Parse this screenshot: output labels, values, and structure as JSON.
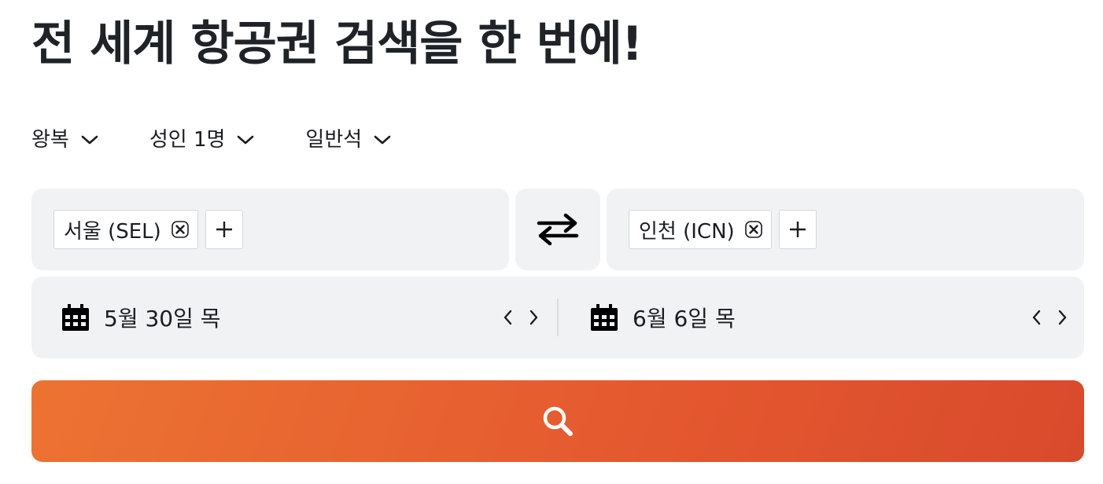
{
  "title": "전 세계 항공권 검색을 한 번에!",
  "options": {
    "trip_type": "왕복",
    "passengers": "성인 1명",
    "cabin": "일반석"
  },
  "origin": {
    "chip_label": "서울 (SEL)"
  },
  "destination": {
    "chip_label": "인천 (ICN)"
  },
  "dates": {
    "depart": "5월 30일 목",
    "return": "6월 6일 목"
  },
  "icons": {
    "chevron": "chevron-down-icon",
    "swap": "swap-arrows-icon",
    "remove": "close-icon",
    "add": "plus-icon",
    "calendar": "calendar-icon",
    "prev": "chevron-left-icon",
    "next": "chevron-right-icon",
    "search": "search-icon"
  },
  "colors": {
    "accent_start": "#ec7332",
    "accent_end": "#d84a2c",
    "field_bg": "#f1f2f4"
  }
}
